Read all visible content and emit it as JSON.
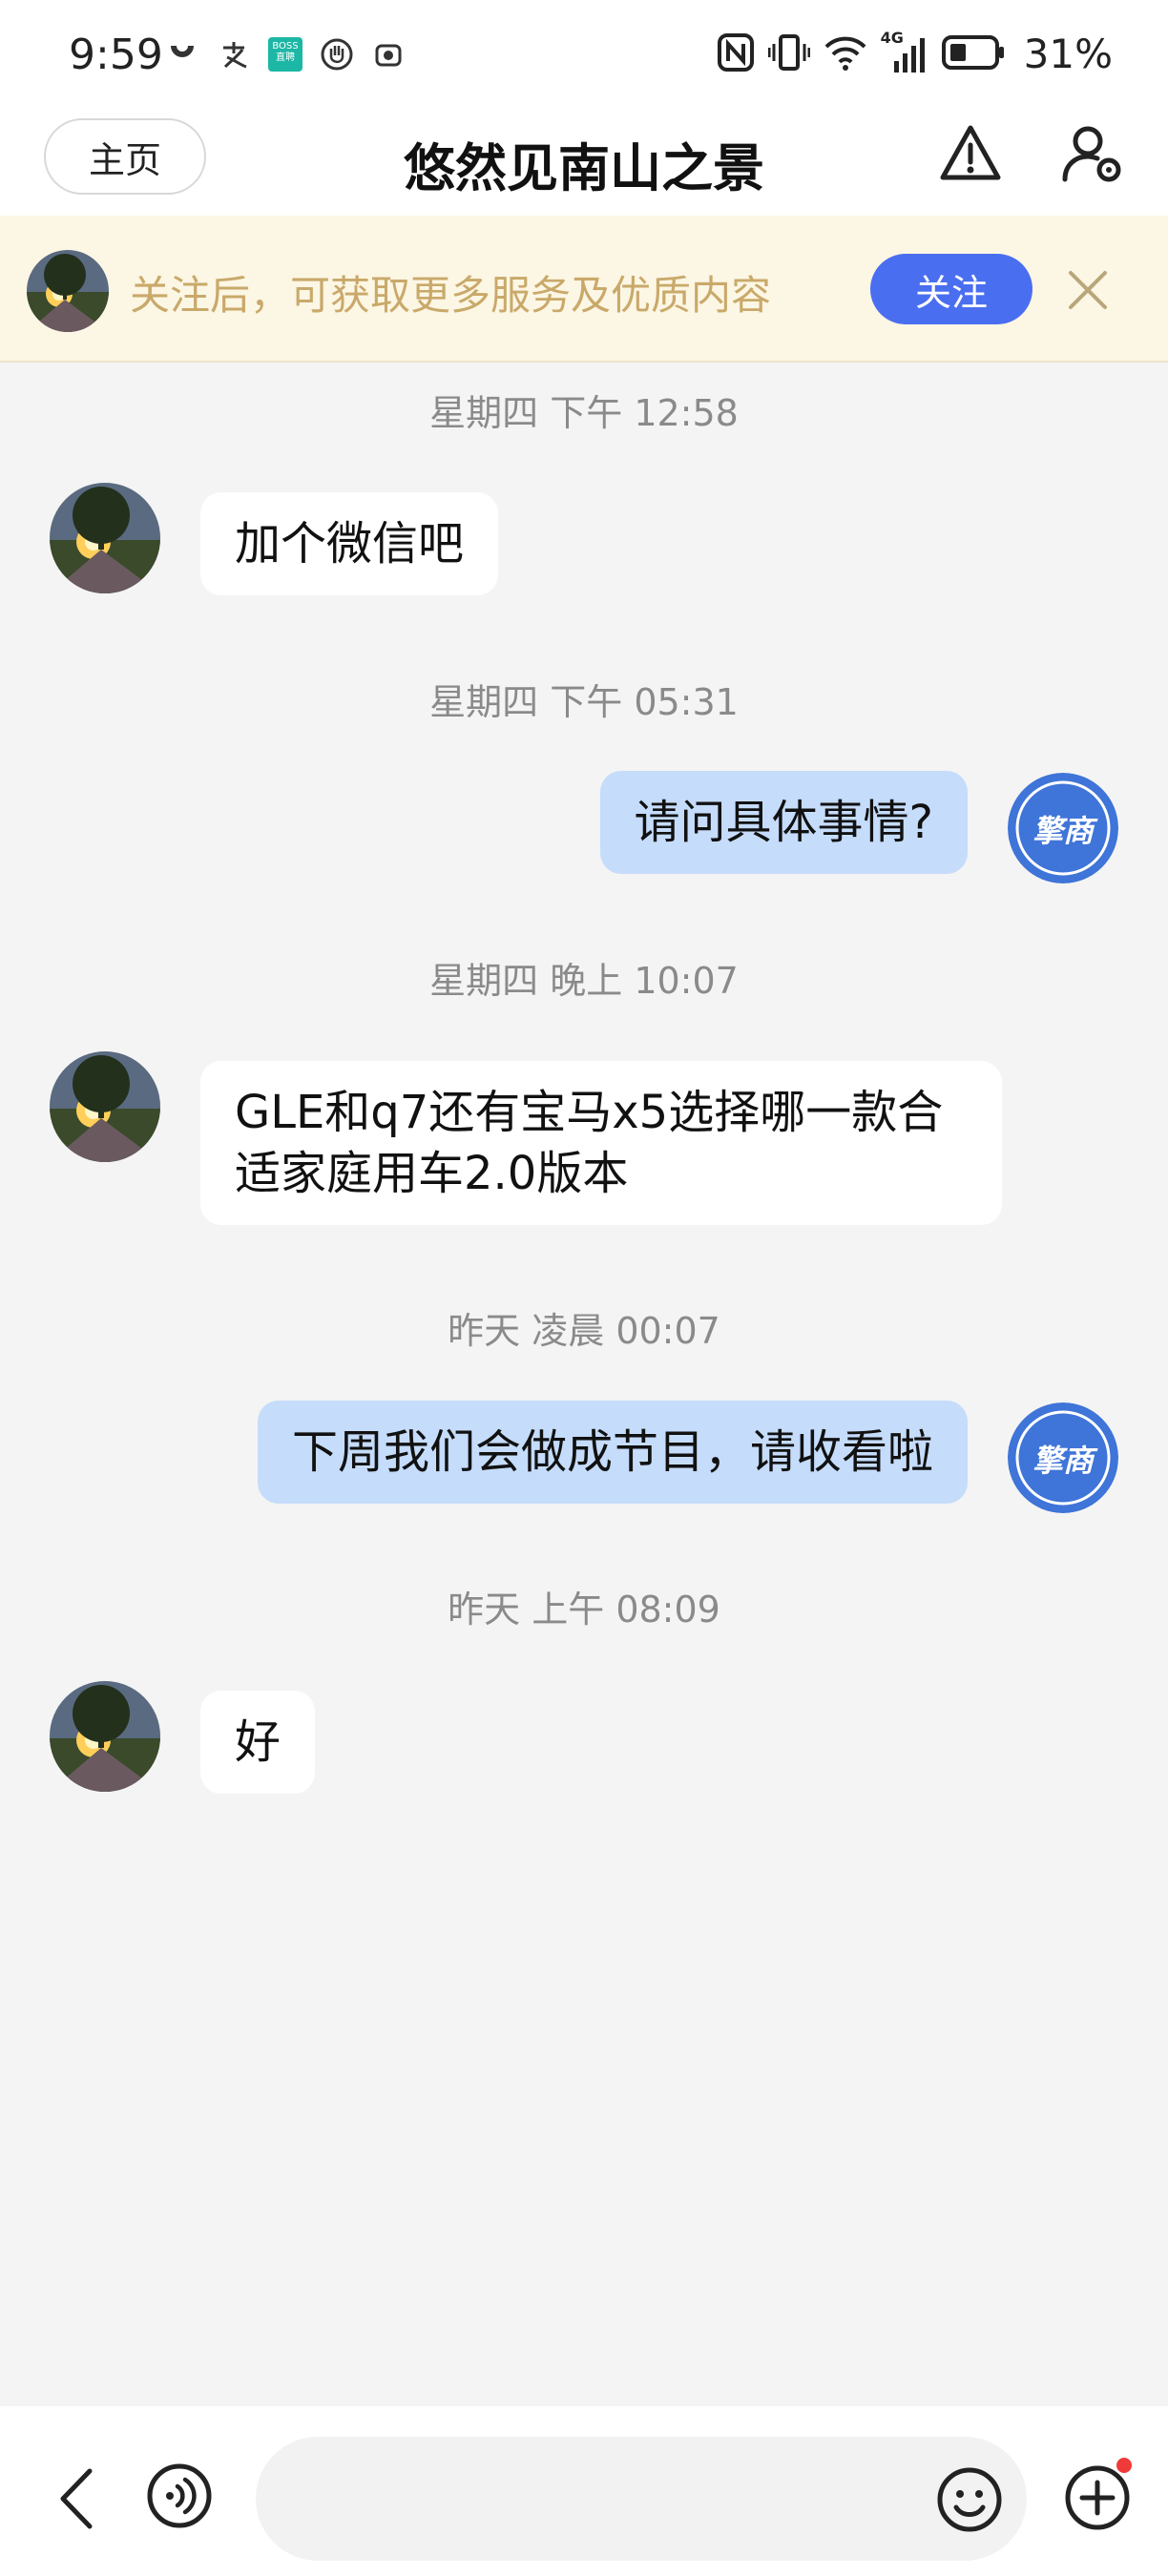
{
  "status_bar": {
    "time": "9:59",
    "left_icons": [
      "didi-icon",
      "alipay-icon",
      "boss-zhipin-icon",
      "hand-icon",
      "camera-icon"
    ],
    "boss_badge_text": "BOSS直聘",
    "right_icons": [
      "nfc-icon",
      "vibrate-icon",
      "wifi-icon",
      "signal-4g-icon",
      "battery-icon"
    ],
    "network": "4G",
    "battery": "31%"
  },
  "nav": {
    "home_label": "主页",
    "title": "悠然见南山之景"
  },
  "banner": {
    "text": "关注后，可获取更多服务及优质内容",
    "follow_label": "关注",
    "follow_color": "#4a6ef0",
    "background": "#fcf6e4"
  },
  "messages": [
    {
      "timestamp": "星期四 下午 12:58",
      "from": "other",
      "text": "加个微信吧"
    },
    {
      "timestamp": "星期四 下午 05:31",
      "from": "me",
      "text": "请问具体事情?"
    },
    {
      "timestamp": "星期四 晚上 10:07",
      "from": "other",
      "lines": [
        "GLE和q7还有宝马x5选择哪一款合",
        "适家庭用车2.0版本"
      ]
    },
    {
      "timestamp": "昨天 凌晨 00:07",
      "from": "me",
      "text": "下周我们会做成节目，请收看啦"
    },
    {
      "timestamp": "昨天 上午 08:09",
      "from": "other",
      "text": "好"
    }
  ],
  "my_avatar_text": "擎商",
  "colors": {
    "incoming_bubble": "#ffffff",
    "outgoing_bubble": "#c5dcfb",
    "my_avatar_bg": "#3f74d8",
    "unread_dot": "#f03a3a"
  },
  "input": {
    "value": "",
    "placeholder": ""
  }
}
